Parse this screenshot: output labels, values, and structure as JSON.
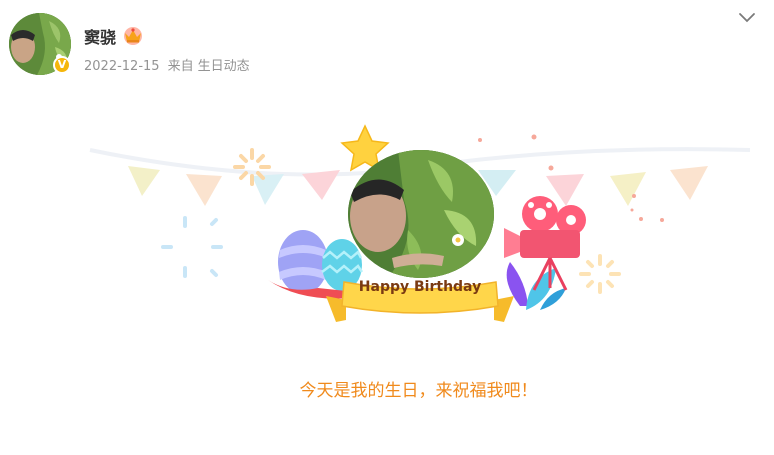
{
  "user": {
    "name": "窦骁",
    "verified_mark": "V",
    "avatar": "user-avatar-photo"
  },
  "post": {
    "date": "2022-12-15",
    "source_prefix": "来自",
    "source": "生日动态"
  },
  "card": {
    "banner": "Happy Birthday",
    "caption": "今天是我的生日，来祝福我吧！"
  },
  "colors": {
    "caption": "#f08a1c",
    "banner_ribbon": "#ffd64a",
    "verified_badge": "#f5b60b"
  },
  "icons": [
    "crown-icon",
    "chevron-down-icon",
    "star-icon",
    "camera-icon",
    "easter-egg-icon"
  ]
}
